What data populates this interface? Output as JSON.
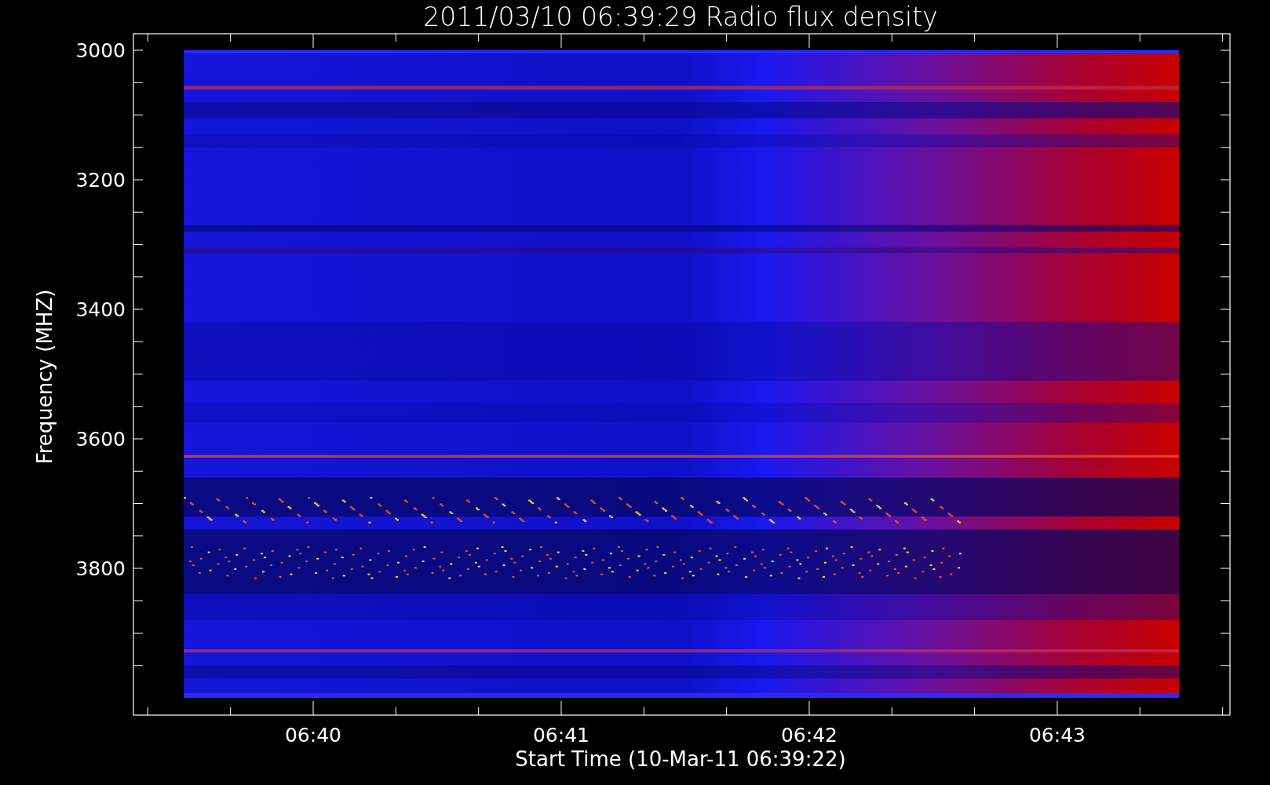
{
  "title": "2011/03/10 06:39:29 Radio flux density",
  "y_axis": {
    "label": "Frequency (MHZ)",
    "ticks": [
      "3000",
      "3200",
      "3400",
      "3600",
      "3800"
    ]
  },
  "x_axis": {
    "label": "Start Time (10-Mar-11 06:39:22)",
    "ticks": [
      "06:40",
      "06:41",
      "06:42",
      "06:43"
    ]
  }
}
